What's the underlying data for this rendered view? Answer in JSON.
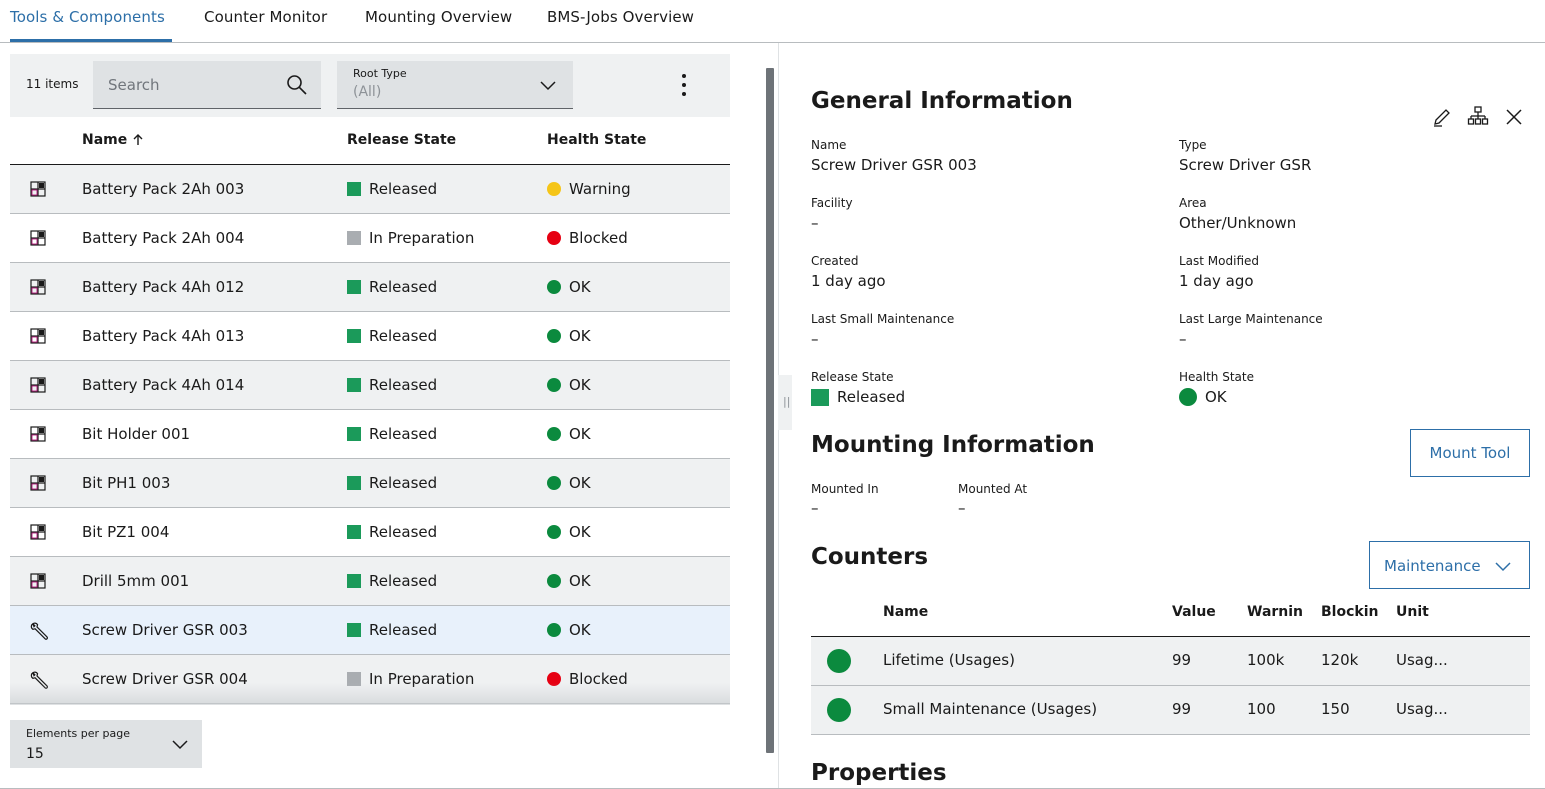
{
  "tabs": [
    {
      "label": "Tools & Components",
      "active": true
    },
    {
      "label": "Counter Monitor",
      "active": false
    },
    {
      "label": "Mounting Overview",
      "active": false
    },
    {
      "label": "BMS-Jobs Overview",
      "active": false
    }
  ],
  "toolbar": {
    "items_count": "11 items",
    "search_placeholder": "Search",
    "root_type_label": "Root Type",
    "root_type_value": "(All)"
  },
  "table": {
    "headers": {
      "name": "Name",
      "release": "Release State",
      "health": "Health State"
    },
    "rows": [
      {
        "name": "Battery Pack 2Ah 003",
        "release": "Released",
        "health": "Warning",
        "icon": "component-icon"
      },
      {
        "name": "Battery Pack 2Ah 004",
        "release": "In Preparation",
        "health": "Blocked",
        "icon": "component-icon"
      },
      {
        "name": "Battery Pack 4Ah 012",
        "release": "Released",
        "health": "OK",
        "icon": "component-icon"
      },
      {
        "name": "Battery Pack 4Ah 013",
        "release": "Released",
        "health": "OK",
        "icon": "component-icon"
      },
      {
        "name": "Battery Pack 4Ah 014",
        "release": "Released",
        "health": "OK",
        "icon": "component-icon"
      },
      {
        "name": "Bit Holder 001",
        "release": "Released",
        "health": "OK",
        "icon": "component-icon"
      },
      {
        "name": "Bit PH1 003",
        "release": "Released",
        "health": "OK",
        "icon": "component-icon"
      },
      {
        "name": "Bit PZ1 004",
        "release": "Released",
        "health": "OK",
        "icon": "component-icon"
      },
      {
        "name": "Drill 5mm 001",
        "release": "Released",
        "health": "OK",
        "icon": "component-icon"
      },
      {
        "name": "Screw Driver GSR 003",
        "release": "Released",
        "health": "OK",
        "icon": "wrench-icon",
        "selected": true
      },
      {
        "name": "Screw Driver GSR 004",
        "release": "In Preparation",
        "health": "Blocked",
        "icon": "wrench-icon"
      }
    ]
  },
  "pagination": {
    "label": "Elements per page",
    "value": "15"
  },
  "colors": {
    "accent": "#2d6fa8",
    "released": "#1b9a5a",
    "in_preparation": "#a9adb1",
    "ok": "#0b8a3e",
    "warning": "#f5c518",
    "blocked": "#e60012"
  },
  "general": {
    "title": "General Information",
    "fields": {
      "name_label": "Name",
      "name_value": "Screw Driver GSR 003",
      "type_label": "Type",
      "type_value": "Screw Driver GSR",
      "facility_label": "Facility",
      "facility_value": "–",
      "area_label": "Area",
      "area_value": "Other/Unknown",
      "created_label": "Created",
      "created_value": "1 day ago",
      "modified_label": "Last Modified",
      "modified_value": "1 day ago",
      "small_maint_label": "Last Small Maintenance",
      "small_maint_value": "–",
      "large_maint_label": "Last Large Maintenance",
      "large_maint_value": "–",
      "release_label": "Release State",
      "release_value": "Released",
      "health_label": "Health State",
      "health_value": "OK"
    }
  },
  "mounting": {
    "title": "Mounting Information",
    "button": "Mount Tool",
    "mounted_in_label": "Mounted In",
    "mounted_in_value": "–",
    "mounted_at_label": "Mounted At",
    "mounted_at_value": "–"
  },
  "counters": {
    "title": "Counters",
    "filter_value": "Maintenance",
    "headers": {
      "name": "Name",
      "value": "Value",
      "warning": "Warnin",
      "blocking": "Blockin",
      "unit": "Unit"
    },
    "rows": [
      {
        "name": "Lifetime (Usages)",
        "value": "99",
        "warning": "100k",
        "blocking": "120k",
        "unit": "Usag..."
      },
      {
        "name": "Small Maintenance (Usages)",
        "value": "99",
        "warning": "100",
        "blocking": "150",
        "unit": "Usag..."
      }
    ]
  },
  "properties": {
    "title": "Properties"
  }
}
